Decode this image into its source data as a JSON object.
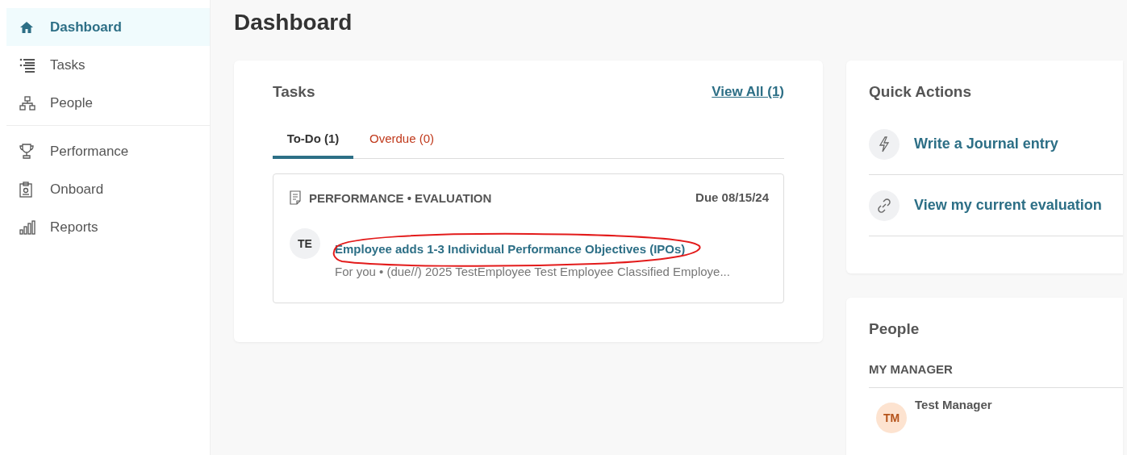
{
  "sidebar": {
    "groups": [
      {
        "items": [
          {
            "label": "Dashboard",
            "selected": true
          },
          {
            "label": "Tasks",
            "selected": false
          },
          {
            "label": "People",
            "selected": false
          }
        ]
      },
      {
        "items": [
          {
            "label": "Performance",
            "selected": false
          },
          {
            "label": "Onboard",
            "selected": false
          },
          {
            "label": "Reports",
            "selected": false
          }
        ]
      }
    ]
  },
  "page_title": "Dashboard",
  "tasks": {
    "title": "Tasks",
    "view_all": "View All (1)",
    "tabs": [
      {
        "label": "To-Do (1)",
        "selected": true,
        "color": "#333333"
      },
      {
        "label": "Overdue (0)",
        "selected": false,
        "color": "#c0391b"
      }
    ],
    "items": [
      {
        "category": "PERFORMANCE • EVALUATION",
        "due": "Due 08/15/24",
        "initials": "TE",
        "title": "Employee adds 1-3 Individual Performance Objectives (IPOs)",
        "subtitle": "For you • (due//) 2025 TestEmployee Test Employee Classified Employe...",
        "circled": true
      }
    ]
  },
  "quick_actions": {
    "title": "Quick Actions",
    "items": [
      {
        "label": "Write a Journal entry"
      },
      {
        "label": "View my current evaluation"
      }
    ]
  },
  "people": {
    "title": "People",
    "section": "MY MANAGER",
    "manager": {
      "initials": "TM",
      "name": "Test Manager"
    }
  }
}
